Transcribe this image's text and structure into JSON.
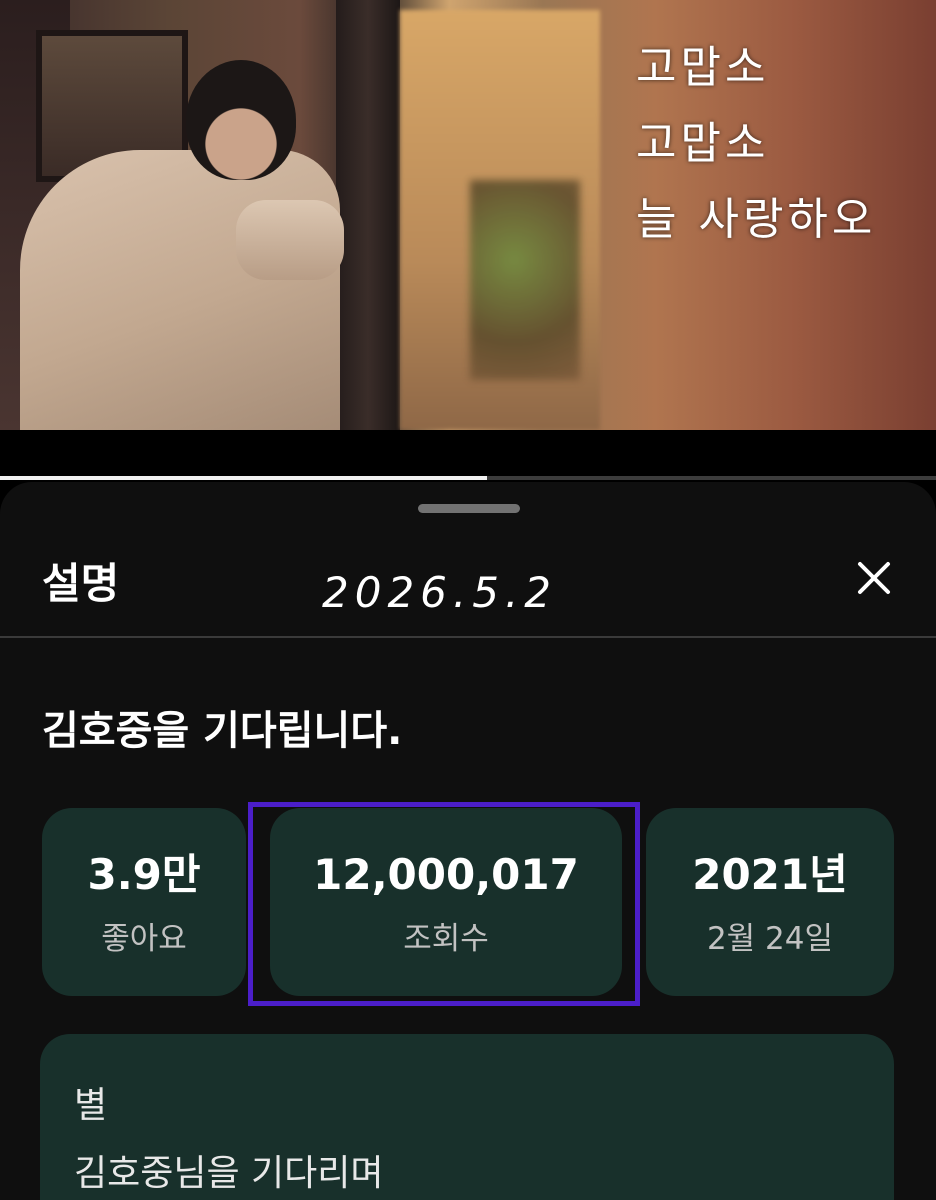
{
  "video": {
    "overlay_lines": [
      "고맙소",
      "고맙소",
      "늘 사랑하오"
    ],
    "progress_fraction": 0.52
  },
  "sheet": {
    "title": "설명",
    "date_stamp": "2026.5.2",
    "close_icon": "close-icon",
    "video_title": "김호중을 기다립니다.",
    "stats": {
      "likes": {
        "value": "3.9만",
        "label": "좋아요"
      },
      "views": {
        "value": "12,000,017",
        "label": "조회수"
      },
      "date": {
        "value": "2021년",
        "label": "2월 24일"
      }
    },
    "highlight_color": "#4b1ec9",
    "description": [
      "별",
      "김호중님을 기다리며"
    ]
  },
  "colors": {
    "sheet_bg": "#0f0f0f",
    "stat_bg": "#18302b"
  }
}
